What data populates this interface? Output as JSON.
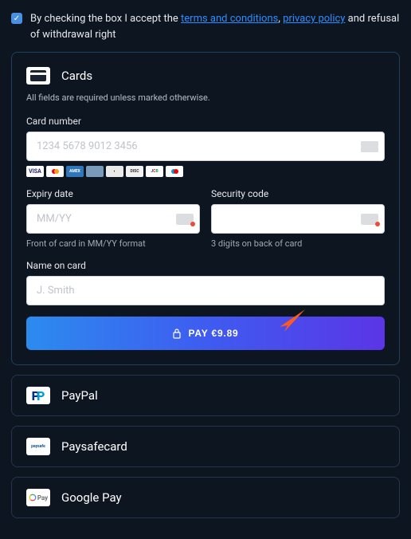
{
  "terms": {
    "prefix": "By checking the box I accept the ",
    "terms_link": "terms and conditions",
    "sep": ",",
    "privacy_link": "privacy policy",
    "suffix": " and refusal of withdrawal right"
  },
  "cards": {
    "title": "Cards",
    "note": "All fields are required unless marked otherwise.",
    "card_number": {
      "label": "Card number",
      "placeholder": "1234 5678 9012 3456"
    },
    "expiry": {
      "label": "Expiry date",
      "placeholder": "MM/YY",
      "helper": "Front of card in MM/YY format"
    },
    "security": {
      "label": "Security code",
      "helper": "3 digits on back of card"
    },
    "name": {
      "label": "Name on card",
      "placeholder": "J. Smith"
    },
    "pay_label": "PAY €9.89",
    "brands": [
      "visa",
      "mastercard",
      "amex",
      "other",
      "diners",
      "discover",
      "jcb",
      "maestro"
    ]
  },
  "methods": {
    "paypal": "PayPal",
    "paysafecard": "Paysafecard",
    "gpay": "Google Pay"
  }
}
